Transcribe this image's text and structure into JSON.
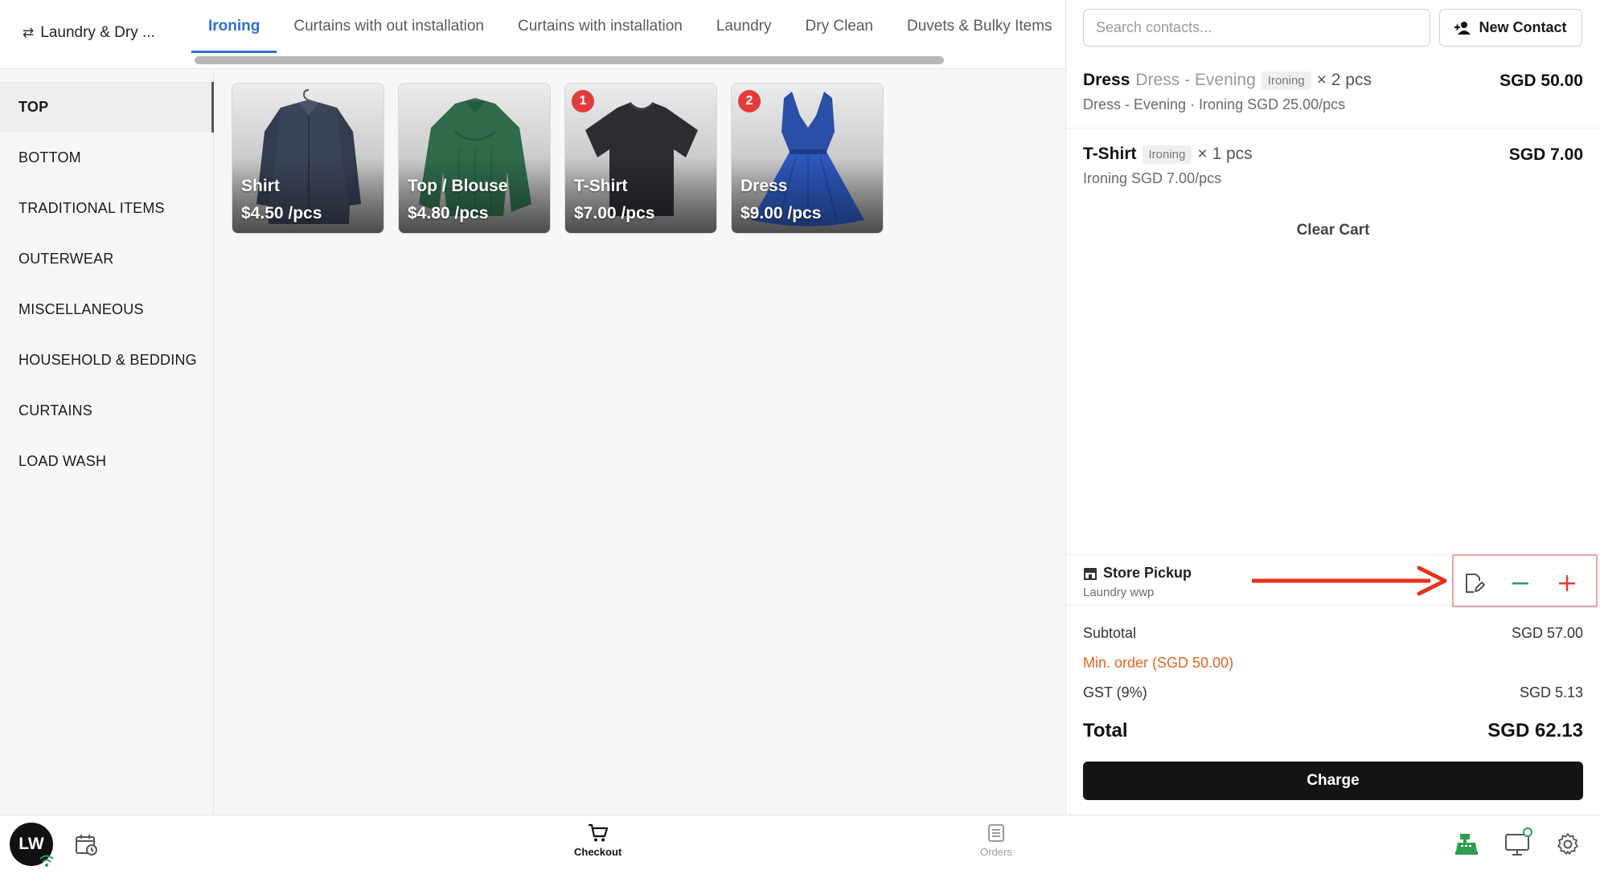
{
  "store": {
    "name": "Laundry & Dry ...",
    "switch_icon": "swap-arrows-icon"
  },
  "tabs": [
    {
      "label": "Ironing",
      "active": true
    },
    {
      "label": "Curtains with out installation",
      "active": false
    },
    {
      "label": "Curtains with installation",
      "active": false
    },
    {
      "label": "Laundry",
      "active": false
    },
    {
      "label": "Dry Clean",
      "active": false
    },
    {
      "label": "Duvets & Bulky Items",
      "active": false
    }
  ],
  "categories": [
    {
      "label": "TOP",
      "active": true
    },
    {
      "label": "BOTTOM",
      "active": false
    },
    {
      "label": "TRADITIONAL ITEMS",
      "active": false
    },
    {
      "label": "OUTERWEAR",
      "active": false
    },
    {
      "label": "MISCELLANEOUS",
      "active": false
    },
    {
      "label": "HOUSEHOLD & BEDDING",
      "active": false
    },
    {
      "label": "CURTAINS",
      "active": false
    },
    {
      "label": "LOAD WASH",
      "active": false
    }
  ],
  "products": [
    {
      "name": "Shirt",
      "price": "$4.50 /pcs",
      "badge": "",
      "image": "shirt-image"
    },
    {
      "name": "Top / Blouse",
      "price": "$4.80 /pcs",
      "badge": "",
      "image": "blouse-image"
    },
    {
      "name": "T-Shirt",
      "price": "$7.00 /pcs",
      "badge": "1",
      "image": "tshirt-image"
    },
    {
      "name": "Dress",
      "price": "$9.00 /pcs",
      "badge": "2",
      "image": "dress-image"
    }
  ],
  "contact": {
    "search_placeholder": "Search contacts...",
    "new_contact_label": "New Contact"
  },
  "cart": {
    "items": [
      {
        "name": "Dress",
        "variant": "Dress - Evening",
        "service": "Ironing",
        "qty": "× 2 pcs",
        "detail": "Dress - Evening · Ironing SGD 25.00/pcs",
        "amount": "SGD 50.00"
      },
      {
        "name": "T-Shirt",
        "variant": "",
        "service": "Ironing",
        "qty": "× 1 pcs",
        "detail": "Ironing SGD 7.00/pcs",
        "amount": "SGD 7.00"
      }
    ],
    "clear_label": "Clear Cart"
  },
  "pickup": {
    "title": "Store Pickup",
    "subtitle": "Laundry wwp"
  },
  "summary": {
    "subtotal_label": "Subtotal",
    "subtotal_value": "SGD 57.00",
    "min_order_label": "Min. order (SGD 50.00)",
    "gst_label": "GST (9%)",
    "gst_value": "SGD 5.13",
    "total_label": "Total",
    "total_value": "SGD 62.13",
    "charge_label": "Charge"
  },
  "bottom_nav": {
    "avatar_initials": "LW",
    "checkout_label": "Checkout",
    "orders_label": "Orders"
  },
  "colors": {
    "accent": "#2f6fd6",
    "badge": "#e23b3b",
    "warning": "#e6631f",
    "minus": "#2e9e4f",
    "plus": "#e23b3b",
    "annotation": "#e8311c"
  }
}
